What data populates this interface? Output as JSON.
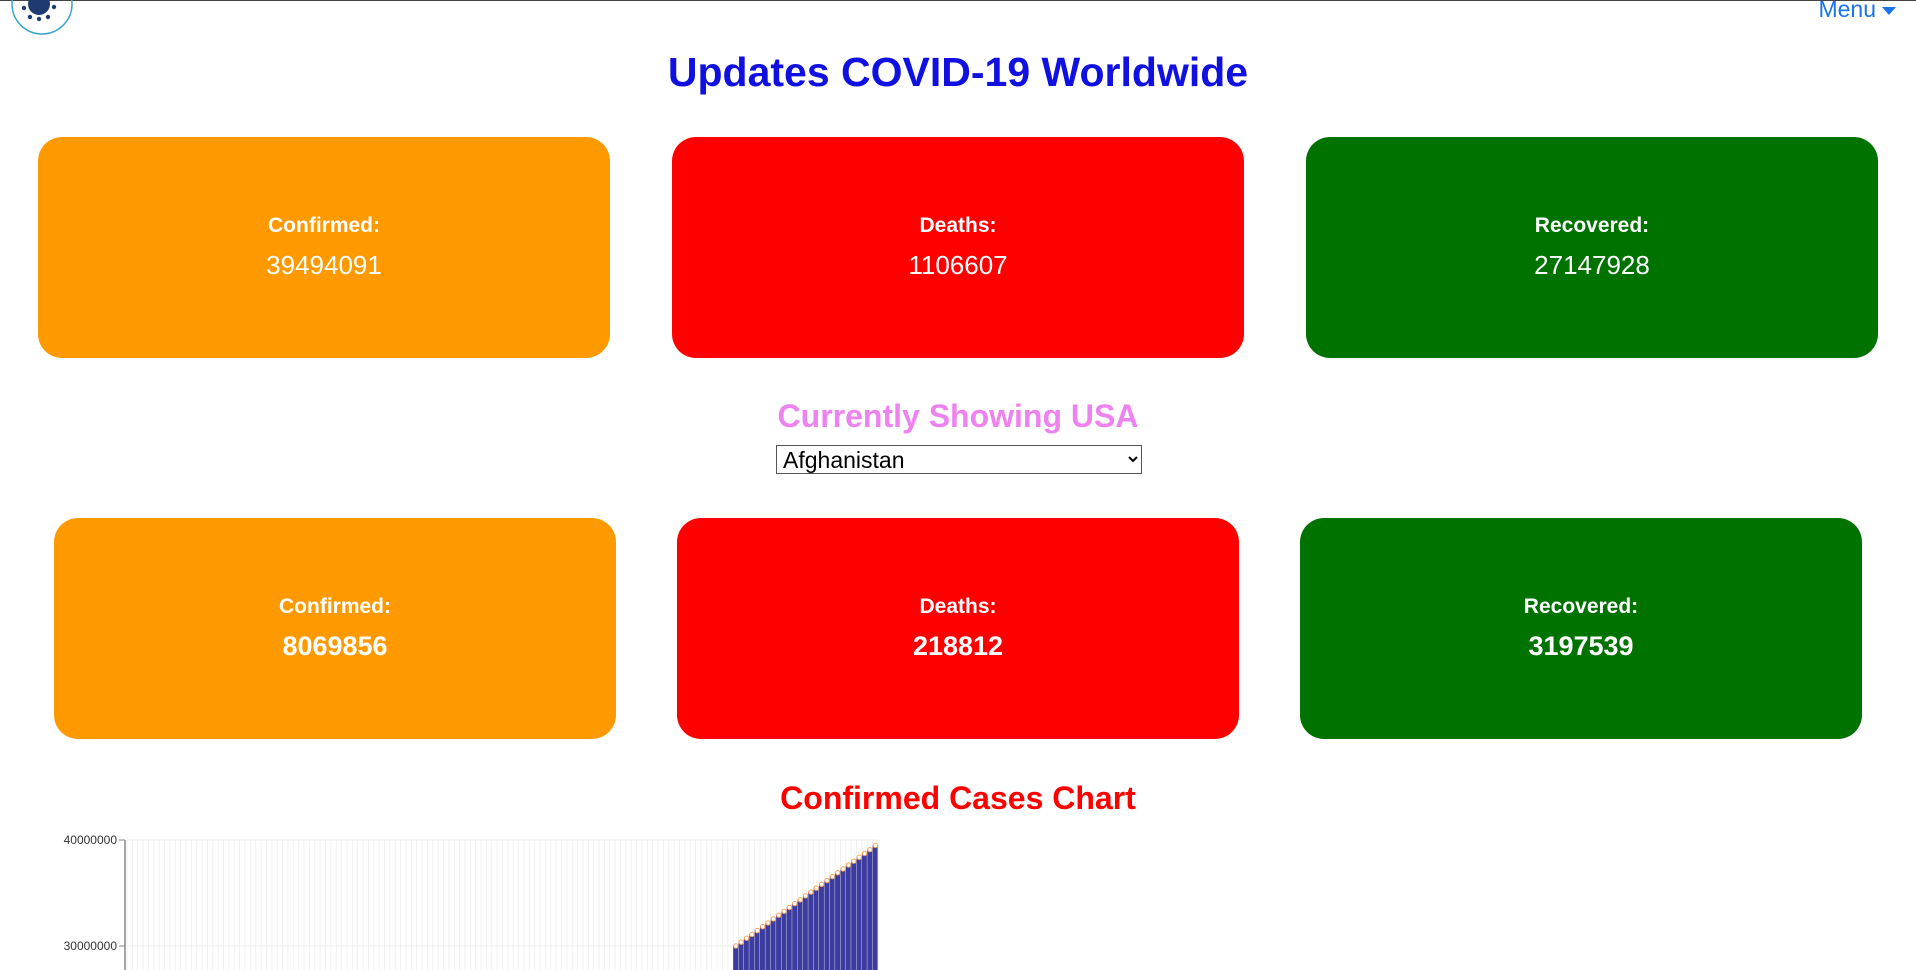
{
  "header": {
    "logo_icon": "virus-icon",
    "menu_label": "Menu"
  },
  "page_title": "Updates COVID-19 Worldwide",
  "worldwide": {
    "confirmed_label": "Confirmed:",
    "confirmed_value": "39494091",
    "deaths_label": "Deaths:",
    "deaths_value": "1106607",
    "recovered_label": "Recovered:",
    "recovered_value": "27147928"
  },
  "currently_showing": "Currently Showing USA",
  "country_select": {
    "selected": "Afghanistan"
  },
  "country": {
    "confirmed_label": "Confirmed:",
    "confirmed_value": "8069856",
    "deaths_label": "Deaths:",
    "deaths_value": "218812",
    "recovered_label": "Recovered:",
    "recovered_value": "3197539"
  },
  "colors": {
    "confirmed": "#fe9a00",
    "deaths": "#ff0000",
    "recovered": "#007200",
    "title": "#1010e0",
    "subtitle": "#ee82ee",
    "chart_title": "#ff0000",
    "bar": "#3c3ca0",
    "point": "#f5a05a"
  },
  "chart_title": "Confirmed Cases Chart",
  "chart_data": {
    "type": "bar",
    "ytick_labels": [
      "40000000",
      "30000000"
    ],
    "ylim": [
      0,
      40000000
    ],
    "grid": true,
    "categories_count": 140,
    "values": [
      30000000,
      30360000,
      30730000,
      31090000,
      31450000,
      31820000,
      32180000,
      32550000,
      32910000,
      33270000,
      33640000,
      34000000,
      34360000,
      34730000,
      35090000,
      35450000,
      35820000,
      36180000,
      36550000,
      36910000,
      37270000,
      37640000,
      38000000,
      38360000,
      38730000,
      39090000,
      39494091
    ]
  }
}
